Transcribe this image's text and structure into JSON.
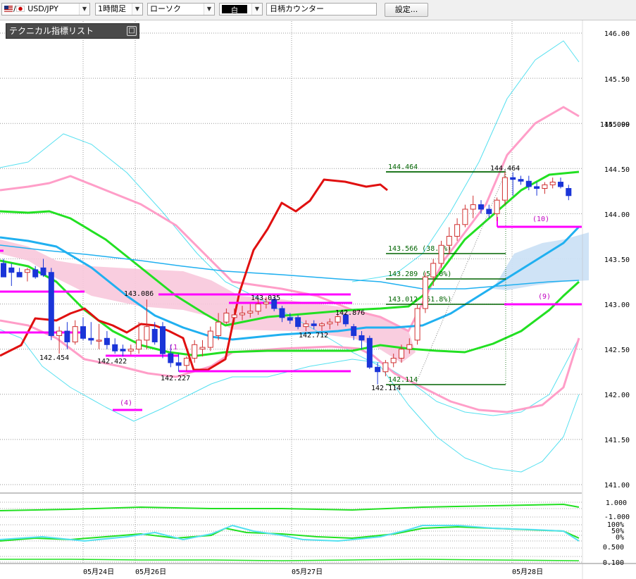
{
  "toolbar": {
    "pair": "USD/JPY",
    "timeframe": "1時間足",
    "chart_type": "ローソク",
    "color_box": "白",
    "counter": "日柄カウンター",
    "settings": "設定..."
  },
  "indicator_list": {
    "title": "テクニカル指標リスト",
    "toggle": "□"
  },
  "colors": {
    "bull": "#d03030",
    "bear": "#1a35d8",
    "bb_outer": "#55e0f0",
    "bb_inner": "#ff9ec8",
    "sma": "#22e022",
    "ema": "#20b0f0",
    "span": "#e01010",
    "level_magenta": "#ff00ff",
    "fib": "#006400",
    "kumo_pink": "#f8c8dc",
    "kumo_blue": "#cce2f6"
  },
  "chart_data": {
    "type": "candlestick",
    "price_axis": [
      "146.00",
      "145.50",
      "145.099",
      "145.00",
      "144.50",
      "144.00",
      "143.50",
      "143.00",
      "142.50",
      "142.00",
      "141.50",
      "141.00"
    ],
    "date_labels": [
      "05月24日",
      "05月26日",
      "05月27日",
      "05月28日"
    ],
    "ylim": [
      140.9,
      146.1
    ],
    "candles": [
      [
        143.45,
        143.5,
        143.3,
        143.3
      ],
      [
        143.4,
        143.45,
        143.2,
        143.35
      ],
      [
        143.35,
        143.4,
        143.3,
        143.3
      ],
      [
        143.35,
        143.4,
        143.25,
        143.38
      ],
      [
        143.38,
        143.42,
        143.28,
        143.3
      ],
      [
        143.4,
        143.5,
        143.3,
        143.32
      ],
      [
        143.35,
        143.4,
        142.6,
        142.65
      ],
      [
        142.65,
        142.75,
        142.45,
        142.7
      ],
      [
        142.7,
        142.8,
        142.5,
        142.58
      ],
      [
        142.58,
        142.82,
        142.55,
        142.75
      ],
      [
        142.75,
        142.85,
        142.6,
        142.62
      ],
      [
        142.62,
        142.8,
        142.55,
        142.6
      ],
      [
        142.6,
        142.78,
        142.5,
        142.6
      ],
      [
        142.62,
        142.7,
        142.5,
        142.55
      ],
      [
        142.55,
        142.62,
        142.45,
        142.48
      ],
      [
        142.5,
        142.55,
        142.42,
        142.48
      ],
      [
        142.48,
        142.55,
        142.44,
        142.5
      ],
      [
        142.5,
        142.8,
        142.45,
        142.6
      ],
      [
        142.6,
        143.05,
        142.5,
        142.75
      ],
      [
        142.72,
        142.8,
        142.55,
        142.58
      ],
      [
        142.75,
        142.8,
        142.4,
        142.45
      ],
      [
        142.45,
        142.55,
        142.3,
        142.35
      ],
      [
        142.35,
        142.45,
        142.25,
        142.32
      ],
      [
        142.32,
        142.42,
        142.26,
        142.4
      ],
      [
        142.4,
        142.6,
        142.35,
        142.55
      ],
      [
        142.5,
        142.6,
        142.42,
        142.52
      ],
      [
        142.52,
        142.75,
        142.48,
        142.7
      ],
      [
        142.65,
        142.9,
        142.6,
        142.8
      ],
      [
        142.8,
        142.95,
        142.78,
        142.9
      ],
      [
        142.85,
        142.95,
        142.8,
        142.88
      ],
      [
        142.88,
        142.98,
        142.82,
        142.9
      ],
      [
        142.9,
        143.0,
        142.85,
        142.92
      ],
      [
        142.92,
        143.05,
        142.88,
        143.0
      ],
      [
        143.0,
        143.08,
        142.95,
        143.02
      ],
      [
        143.05,
        143.08,
        142.92,
        142.95
      ],
      [
        142.95,
        142.98,
        142.8,
        142.85
      ],
      [
        142.85,
        142.9,
        142.78,
        142.82
      ],
      [
        142.85,
        142.88,
        142.72,
        142.75
      ],
      [
        142.75,
        142.82,
        142.7,
        142.78
      ],
      [
        142.78,
        142.82,
        142.72,
        142.76
      ],
      [
        142.76,
        142.8,
        142.7,
        142.78
      ],
      [
        142.78,
        142.84,
        142.72,
        142.8
      ],
      [
        142.8,
        142.88,
        142.76,
        142.86
      ],
      [
        142.88,
        142.9,
        142.75,
        142.78
      ],
      [
        142.75,
        142.78,
        142.6,
        142.65
      ],
      [
        142.65,
        142.7,
        142.5,
        142.6
      ],
      [
        142.62,
        142.65,
        142.28,
        142.3
      ],
      [
        142.3,
        142.35,
        142.11,
        142.25
      ],
      [
        142.25,
        142.38,
        142.2,
        142.35
      ],
      [
        142.35,
        142.45,
        142.3,
        142.4
      ],
      [
        142.4,
        142.55,
        142.35,
        142.5
      ],
      [
        142.5,
        142.62,
        142.45,
        142.55
      ],
      [
        142.6,
        143.0,
        142.55,
        142.95
      ],
      [
        142.95,
        143.35,
        142.9,
        143.3
      ],
      [
        143.3,
        143.5,
        143.2,
        143.45
      ],
      [
        143.45,
        143.7,
        143.4,
        143.65
      ],
      [
        143.65,
        143.85,
        143.55,
        143.75
      ],
      [
        143.75,
        143.95,
        143.7,
        143.88
      ],
      [
        143.88,
        144.1,
        143.85,
        144.05
      ],
      [
        144.05,
        144.2,
        143.95,
        144.1
      ],
      [
        144.1,
        144.15,
        144.0,
        144.05
      ],
      [
        144.05,
        144.1,
        143.95,
        144.0
      ],
      [
        144.0,
        144.18,
        143.92,
        144.15
      ],
      [
        144.15,
        144.464,
        144.1,
        144.4
      ],
      [
        144.4,
        144.46,
        144.2,
        144.38
      ],
      [
        144.38,
        144.42,
        144.32,
        144.36
      ],
      [
        144.36,
        144.42,
        144.26,
        144.3
      ],
      [
        144.3,
        144.35,
        144.2,
        144.28
      ],
      [
        144.28,
        144.35,
        144.22,
        144.32
      ],
      [
        144.32,
        144.4,
        144.28,
        144.35
      ],
      [
        144.35,
        144.4,
        144.28,
        144.3
      ],
      [
        144.28,
        144.32,
        144.15,
        144.2
      ]
    ],
    "annotations": {
      "lows_highs": [
        "142.454",
        "142.422",
        "142.227",
        "143.086",
        "143.035",
        "142.876",
        "142.712",
        "142.114",
        "144.464"
      ],
      "fib_labels": [
        "144.464",
        "143.566 (38.2%)",
        "143.289 (50.0%)",
        "143.012 (61.8%)",
        "142.114"
      ],
      "counters": [
        "(4)",
        "(10)",
        "(9)",
        "(1"
      ]
    },
    "fib_levels": [
      144.464,
      143.566,
      143.289,
      143.012,
      142.114
    ],
    "horizontal_levels": [
      143.3,
      143.13,
      142.85,
      142.46,
      142.27,
      143.03,
      143.88,
      143.01
    ],
    "oscillator_axis_1": [
      "1.000",
      "-1.000"
    ],
    "oscillator_axis_2": [
      "100%",
      "50%",
      "0%",
      "0.500",
      "0.100"
    ]
  }
}
